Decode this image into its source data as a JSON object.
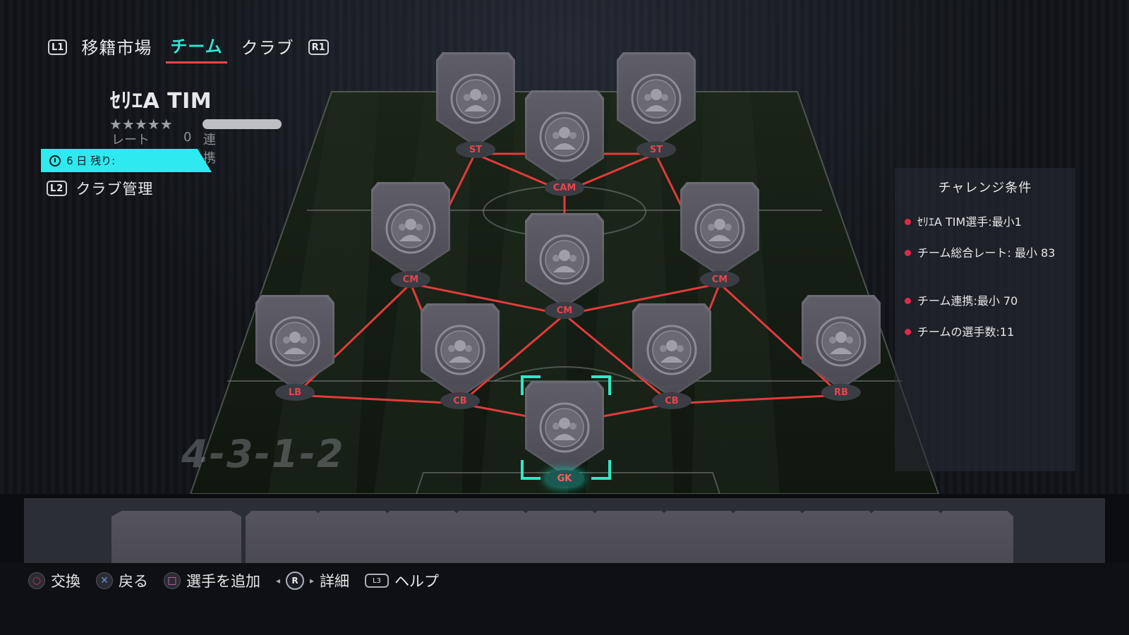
{
  "nav": {
    "left_bumper": "L1",
    "right_bumper": "R1",
    "tabs": [
      {
        "label": "移籍市場",
        "active": false
      },
      {
        "label": "チーム",
        "active": true
      },
      {
        "label": "クラブ",
        "active": false
      }
    ]
  },
  "squad": {
    "name": "ｾﾘｴA TIM",
    "stars": "★★★★★",
    "rating_label": "レート",
    "rating_value": "0",
    "chemistry_label": "連携",
    "timer_text": "6 日 残り:",
    "club_management_button": "L2",
    "club_management_label": "クラブ管理"
  },
  "formation": "4-3-1-2",
  "positions": [
    {
      "label": "ST",
      "selected": false
    },
    {
      "label": "ST",
      "selected": false
    },
    {
      "label": "CAM",
      "selected": false
    },
    {
      "label": "CM",
      "selected": false
    },
    {
      "label": "CM",
      "selected": false
    },
    {
      "label": "CM",
      "selected": false
    },
    {
      "label": "LB",
      "selected": false
    },
    {
      "label": "CB",
      "selected": false
    },
    {
      "label": "CB",
      "selected": false
    },
    {
      "label": "RB",
      "selected": false
    },
    {
      "label": "GK",
      "selected": true
    }
  ],
  "challenge": {
    "title": "チャレンジ条件",
    "requirements": [
      "ｾﾘｴA TIM選手:最小1",
      "チーム総合レート: 最小 83",
      "チーム連携:最小 70",
      "チームの選手数:11"
    ]
  },
  "controls": [
    {
      "icon": "circle-button-icon",
      "label": "交換"
    },
    {
      "icon": "cross-button-icon",
      "label": "戻る"
    },
    {
      "icon": "square-button-icon",
      "label": "選手を追加"
    },
    {
      "icon": "right-stick-icon",
      "button_text": "R",
      "label": "詳細"
    },
    {
      "icon": "touchpad-icon",
      "button_text": "L3",
      "label": "ヘルプ"
    }
  ],
  "colors": {
    "accent_cyan": "#2ee9ef",
    "link_red": "#e23b3b",
    "selection_green": "#2fe9c6",
    "requirement_dot": "#e0294a"
  }
}
